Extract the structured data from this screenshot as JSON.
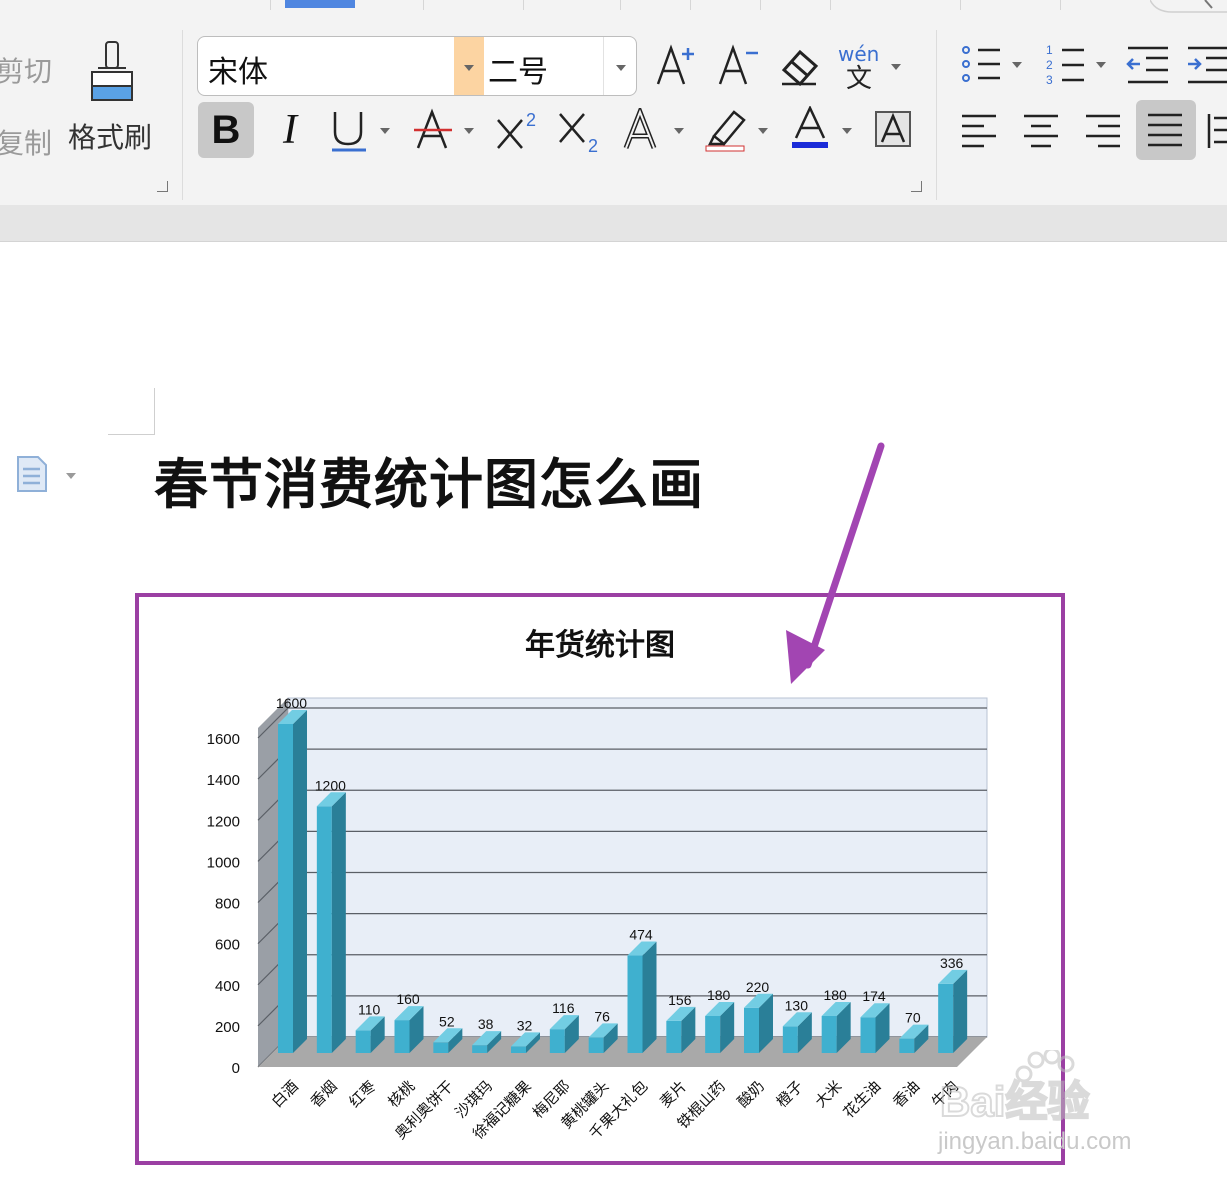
{
  "toolbar": {
    "cut_label": "剪切",
    "copy_label": "复制",
    "format_painter_label": "格式刷",
    "font_name": "宋体",
    "font_size": "二号",
    "pinyin_label": "wén"
  },
  "document": {
    "heading": "春节消费统计图怎么画"
  },
  "chart_data": {
    "type": "bar",
    "title": "年货统计图",
    "categories": [
      "白酒",
      "香烟",
      "红枣",
      "核桃",
      "奥利奥饼干",
      "沙琪玛",
      "徐福记糖果",
      "梅尼耶",
      "黄桃罐头",
      "千果大礼包",
      "麦片",
      "铁棍山药",
      "酸奶",
      "橙子",
      "大米",
      "花生油",
      "香油",
      "牛肉"
    ],
    "values": [
      1600,
      1200,
      110,
      160,
      52,
      38,
      32,
      116,
      76,
      474,
      156,
      180,
      220,
      130,
      180,
      174,
      70,
      336
    ],
    "yticks": [
      0,
      200,
      400,
      600,
      800,
      1000,
      1200,
      1400,
      1600
    ],
    "ylim": [
      0,
      1600
    ],
    "grid": true,
    "colors": {
      "bar_front": "#3fb0cf",
      "bar_side": "#2a7f98",
      "bar_top": "#72cde3",
      "plot_bg": "#e8eef7",
      "floor": "#a9a9a9"
    }
  },
  "accent_colors": {
    "annotation": "#a245b2",
    "frame": "#9b3fa3",
    "toolbar_active": "#4f86e0"
  },
  "watermark": {
    "brand": "Bai经验",
    "url": "jingyan.baidu.com"
  }
}
